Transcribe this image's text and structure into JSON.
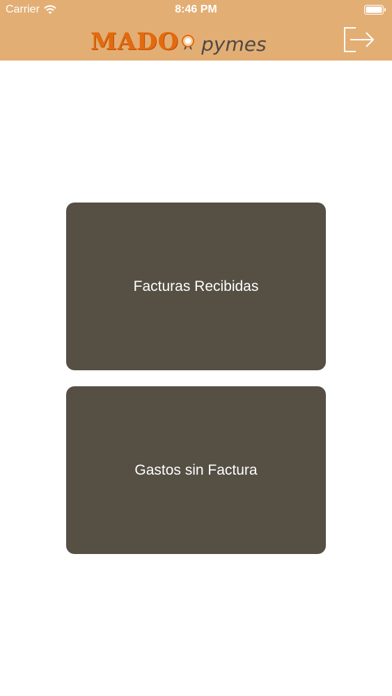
{
  "status_bar": {
    "carrier": "Carrier",
    "time": "8:46 PM",
    "wifi_icon": "wifi-icon",
    "battery_icon": "battery-icon"
  },
  "nav": {
    "brand_main": "MADO",
    "brand_sub": "pymes",
    "logout_icon": "logout-icon",
    "background_color": "#e3ae74"
  },
  "menu": {
    "items": [
      {
        "label": "Facturas Recibidas"
      },
      {
        "label": "Gastos sin Factura"
      }
    ],
    "card_color": "#554f44"
  }
}
